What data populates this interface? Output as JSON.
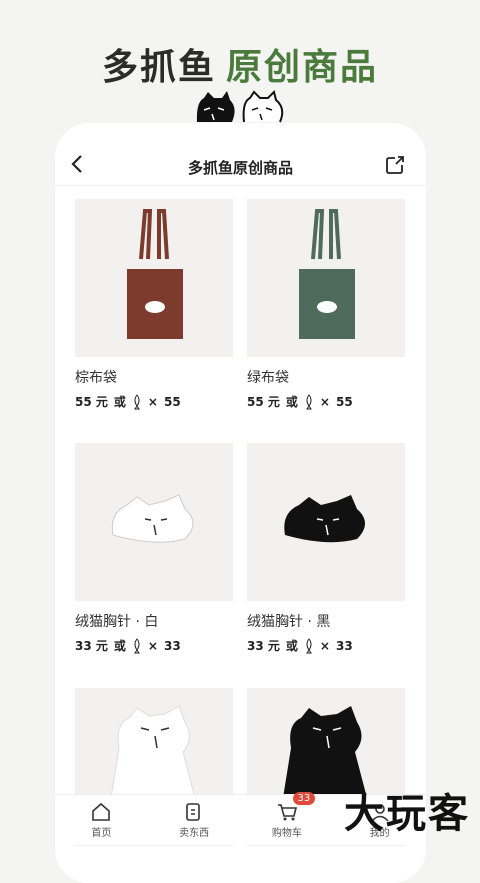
{
  "banner": {
    "part1": "多抓鱼",
    "part2": "原创商品"
  },
  "nav": {
    "title": "多抓鱼原创商品"
  },
  "products": [
    {
      "name": "棕布袋",
      "price": "55 元",
      "or": "或",
      "times": "×",
      "fish": "55",
      "color": "#7c3b2c"
    },
    {
      "name": "绿布袋",
      "price": "55 元",
      "or": "或",
      "times": "×",
      "fish": "55",
      "color": "#4e6b5c"
    },
    {
      "name": "绒猫胸针 · 白",
      "price": "33 元",
      "or": "或",
      "times": "×",
      "fish": "33",
      "color": "#ffffff"
    },
    {
      "name": "绒猫胸针 · 黑",
      "price": "33 元",
      "or": "或",
      "times": "×",
      "fish": "33",
      "color": "#111111"
    }
  ],
  "tabs": [
    {
      "label": "首页",
      "icon": "home-icon"
    },
    {
      "label": "卖东西",
      "icon": "sell-icon"
    },
    {
      "label": "购物车",
      "icon": "cart-icon",
      "badge": "33"
    },
    {
      "label": "我的",
      "icon": "profile-icon"
    }
  ],
  "watermark": "大玩客"
}
